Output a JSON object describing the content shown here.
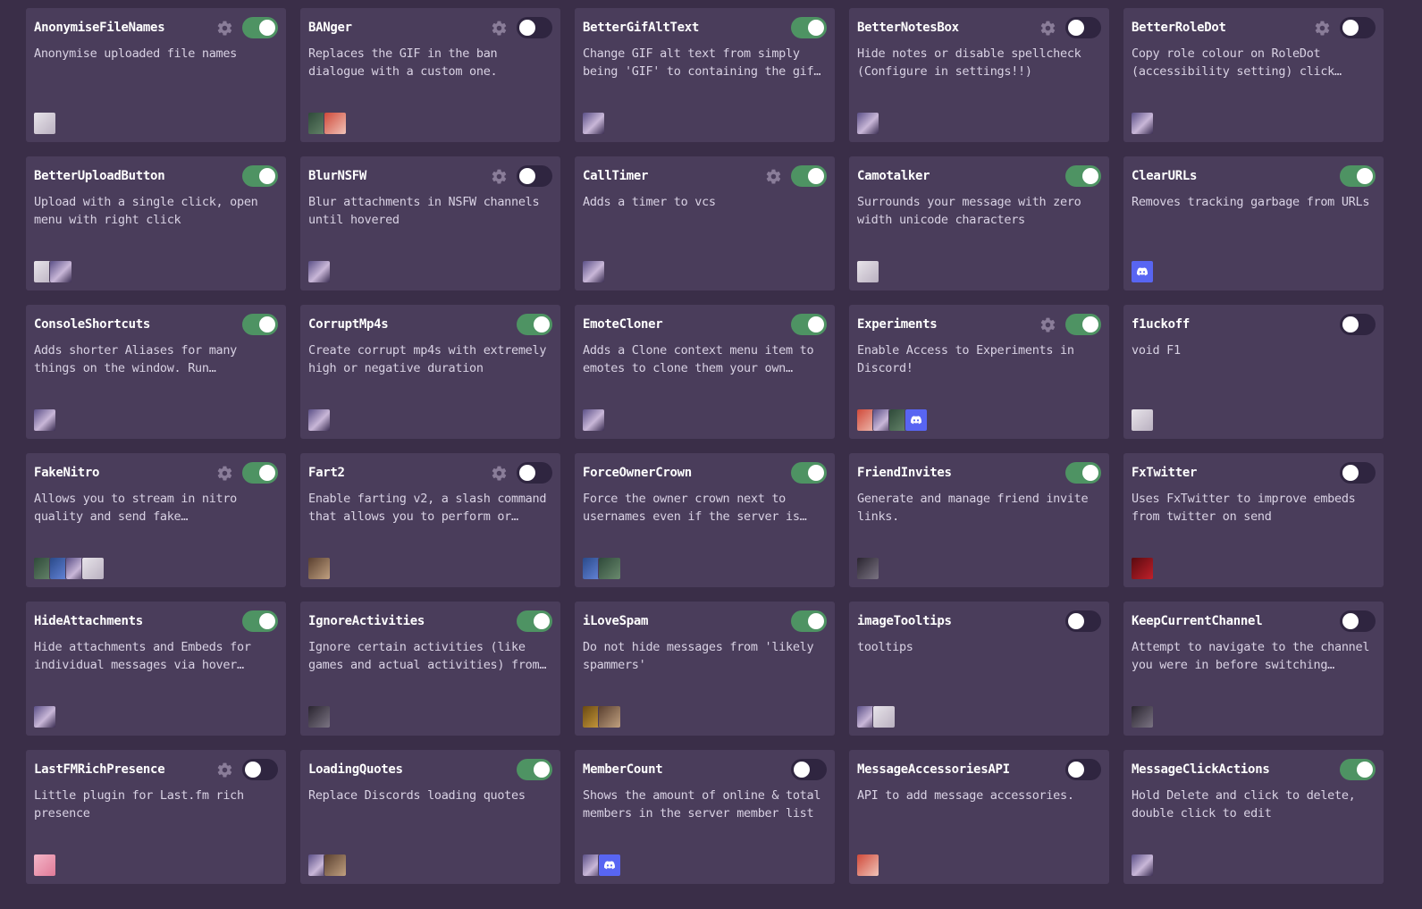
{
  "plugins": [
    {
      "name": "AnonymiseFileNames",
      "description": "Anonymise uploaded file names",
      "enabled": true,
      "settings": true,
      "authors": [
        "white"
      ]
    },
    {
      "name": "BANger",
      "description": "Replaces the GIF in the ban dialogue with a custom one.",
      "enabled": false,
      "settings": true,
      "authors": [
        "green",
        "red"
      ]
    },
    {
      "name": "BetterGifAltText",
      "description": "Change GIF alt text from simply being 'GIF' to containing the gif…",
      "enabled": true,
      "settings": false,
      "authors": [
        "anime"
      ]
    },
    {
      "name": "BetterNotesBox",
      "description": "Hide notes or disable spellcheck (Configure in settings!!)",
      "enabled": false,
      "settings": true,
      "authors": [
        "anime"
      ]
    },
    {
      "name": "BetterRoleDot",
      "description": "Copy role colour on RoleDot (accessibility setting) click…",
      "enabled": false,
      "settings": true,
      "authors": [
        "anime"
      ]
    },
    {
      "name": "BetterUploadButton",
      "description": "Upload with a single click, open menu with right click",
      "enabled": true,
      "settings": false,
      "authors": [
        "white",
        "anime"
      ]
    },
    {
      "name": "BlurNSFW",
      "description": "Blur attachments in NSFW channels until hovered",
      "enabled": false,
      "settings": true,
      "authors": [
        "anime"
      ]
    },
    {
      "name": "CallTimer",
      "description": "Adds a timer to vcs",
      "enabled": true,
      "settings": true,
      "authors": [
        "anime"
      ]
    },
    {
      "name": "Camotalker",
      "description": "Surrounds your message with zero width unicode characters",
      "enabled": true,
      "settings": false,
      "authors": [
        "white"
      ]
    },
    {
      "name": "ClearURLs",
      "description": "Removes tracking garbage from URLs",
      "enabled": true,
      "settings": false,
      "authors": [
        "discord"
      ]
    },
    {
      "name": "ConsoleShortcuts",
      "description": "Adds shorter Aliases for many things on the window. Run…",
      "enabled": true,
      "settings": false,
      "authors": [
        "anime"
      ]
    },
    {
      "name": "CorruptMp4s",
      "description": "Create corrupt mp4s with extremely high or negative duration",
      "enabled": true,
      "settings": false,
      "authors": [
        "anime"
      ]
    },
    {
      "name": "EmoteCloner",
      "description": "Adds a Clone context menu item to emotes to clone them your own…",
      "enabled": true,
      "settings": false,
      "authors": [
        "anime"
      ]
    },
    {
      "name": "Experiments",
      "description": "Enable Access to Experiments in Discord!",
      "enabled": true,
      "settings": true,
      "authors": [
        "red",
        "anime",
        "green",
        "discord"
      ]
    },
    {
      "name": "f1uckoff",
      "description": "void F1",
      "enabled": false,
      "settings": false,
      "authors": [
        "white"
      ]
    },
    {
      "name": "FakeNitro",
      "description": "Allows you to stream in nitro quality and send fake…",
      "enabled": true,
      "settings": true,
      "authors": [
        "green",
        "blue",
        "anime",
        "white"
      ]
    },
    {
      "name": "Fart2",
      "description": "Enable farting v2, a slash command that allows you to perform or…",
      "enabled": false,
      "settings": true,
      "authors": [
        "brown"
      ]
    },
    {
      "name": "ForceOwnerCrown",
      "description": "Force the owner crown next to usernames even if the server is…",
      "enabled": true,
      "settings": false,
      "authors": [
        "blue",
        "green"
      ]
    },
    {
      "name": "FriendInvites",
      "description": "Generate and manage friend invite links.",
      "enabled": true,
      "settings": false,
      "authors": [
        "dark"
      ]
    },
    {
      "name": "FxTwitter",
      "description": "Uses FxTwitter to improve embeds from twitter on send",
      "enabled": false,
      "settings": false,
      "authors": [
        "crimson"
      ]
    },
    {
      "name": "HideAttachments",
      "description": "Hide attachments and Embeds for individual messages via hover…",
      "enabled": true,
      "settings": false,
      "authors": [
        "anime"
      ]
    },
    {
      "name": "IgnoreActivities",
      "description": "Ignore certain activities (like games and actual activities) from…",
      "enabled": true,
      "settings": false,
      "authors": [
        "dark"
      ]
    },
    {
      "name": "iLoveSpam",
      "description": "Do not hide messages from 'likely spammers'",
      "enabled": true,
      "settings": false,
      "authors": [
        "gold",
        "brown"
      ]
    },
    {
      "name": "imageTooltips",
      "description": "tooltips",
      "enabled": false,
      "settings": false,
      "authors": [
        "anime",
        "white"
      ]
    },
    {
      "name": "KeepCurrentChannel",
      "description": "Attempt to navigate to the channel you were in before switching…",
      "enabled": false,
      "settings": false,
      "authors": [
        "dark"
      ]
    },
    {
      "name": "LastFMRichPresence",
      "description": "Little plugin for Last.fm rich presence",
      "enabled": false,
      "settings": true,
      "authors": [
        "pink"
      ]
    },
    {
      "name": "LoadingQuotes",
      "description": "Replace Discords loading quotes",
      "enabled": true,
      "settings": false,
      "authors": [
        "anime",
        "brown"
      ]
    },
    {
      "name": "MemberCount",
      "description": "Shows the amount of online & total members in the server member list",
      "enabled": false,
      "settings": false,
      "authors": [
        "anime",
        "discord"
      ]
    },
    {
      "name": "MessageAccessoriesAPI",
      "description": "API to add message accessories.",
      "enabled": false,
      "settings": false,
      "authors": [
        "red"
      ]
    },
    {
      "name": "MessageClickActions",
      "description": "Hold Delete and click to delete, double click to edit",
      "enabled": true,
      "settings": false,
      "authors": [
        "anime"
      ]
    }
  ]
}
